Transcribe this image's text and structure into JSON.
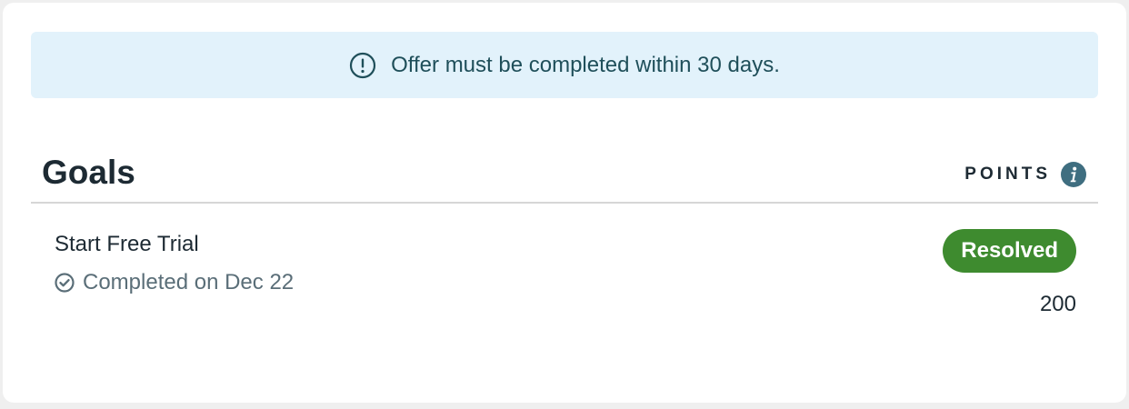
{
  "notice": {
    "icon": "exclamation-circle-icon",
    "text": "Offer must be completed within 30 days."
  },
  "goals": {
    "title": "Goals",
    "points_label": "POINTS",
    "info_icon": "info-icon",
    "items": [
      {
        "name": "Start Free Trial",
        "status_icon": "check-circle-icon",
        "status_text": "Completed on Dec 22",
        "badge": "Resolved",
        "points": "200"
      }
    ]
  },
  "colors": {
    "notice_bg": "#e2f2fb",
    "notice_text": "#1f4f5a",
    "badge_bg": "#3e8b2f",
    "info_icon": "#3f6e80"
  }
}
